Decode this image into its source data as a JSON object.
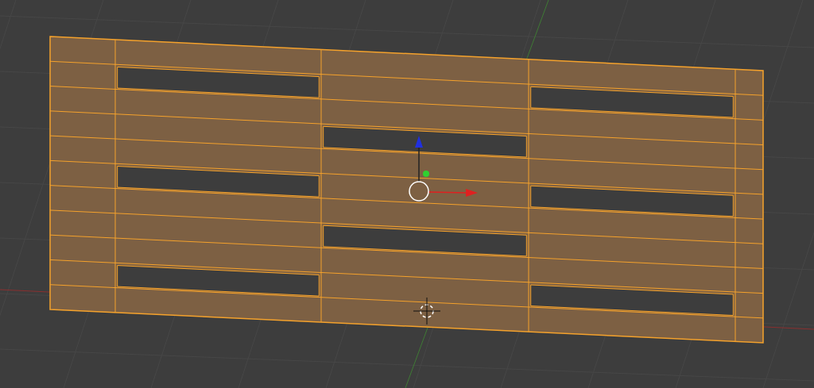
{
  "mesh": {
    "selected": true
  }
}
